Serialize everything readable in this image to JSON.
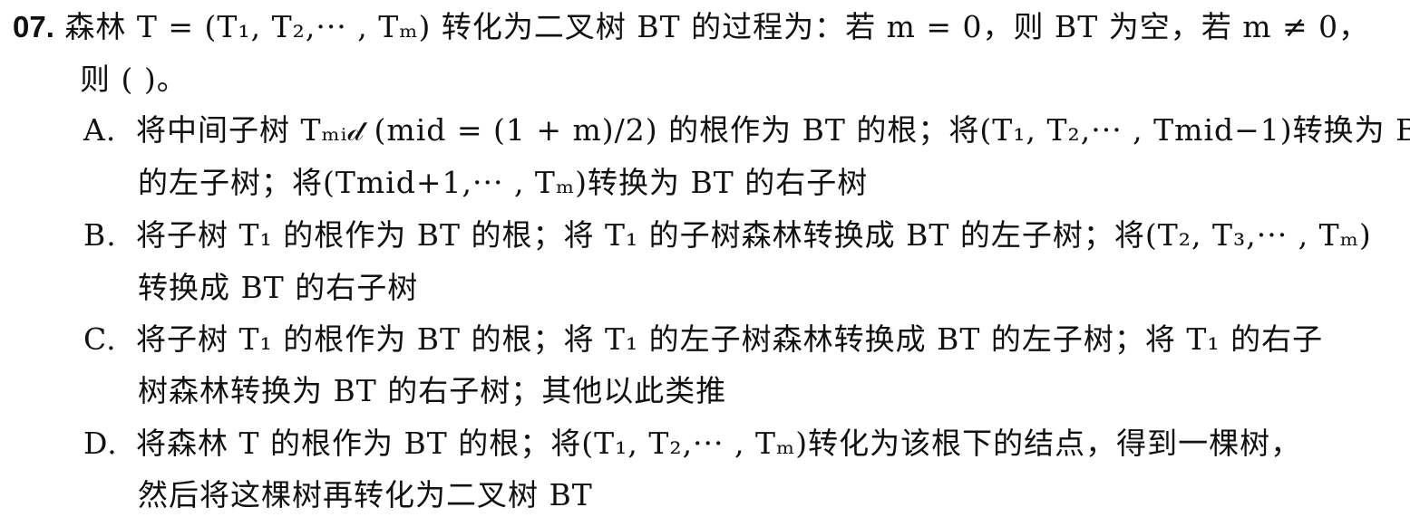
{
  "question": {
    "number": "07.",
    "stem_line1": "森林 T = (T₁, T₂,··· , Tₘ) 转化为二叉树 BT 的过程为：若 m = 0，则 BT 为空，若 m ≠ 0，",
    "stem_line2": "则 (    )。"
  },
  "options": [
    {
      "label": "A.",
      "line1": "将中间子树 Tₘᵢ𝒹 (mid = (1 + m)/2) 的根作为 BT 的根；将(T₁, T₂,··· , Tmid−1)转换为 BT",
      "line2": "的左子树；将(Tmid+1,··· , Tₘ)转换为 BT 的右子树"
    },
    {
      "label": "B.",
      "line1": "将子树 T₁ 的根作为 BT 的根；将 T₁ 的子树森林转换成 BT 的左子树；将(T₂, T₃,··· , Tₘ)",
      "line2": "转换成 BT 的右子树"
    },
    {
      "label": "C.",
      "line1": "将子树 T₁ 的根作为 BT 的根；将 T₁ 的左子树森林转换成 BT 的左子树；将 T₁ 的右子",
      "line2": "树森林转换为 BT 的右子树；其他以此类推"
    },
    {
      "label": "D.",
      "line1": "将森林 T 的根作为 BT 的根；将(T₁, T₂,··· , Tₘ)转化为该根下的结点，得到一棵树，",
      "line2": "然后将这棵树再转化为二叉树 BT"
    }
  ]
}
